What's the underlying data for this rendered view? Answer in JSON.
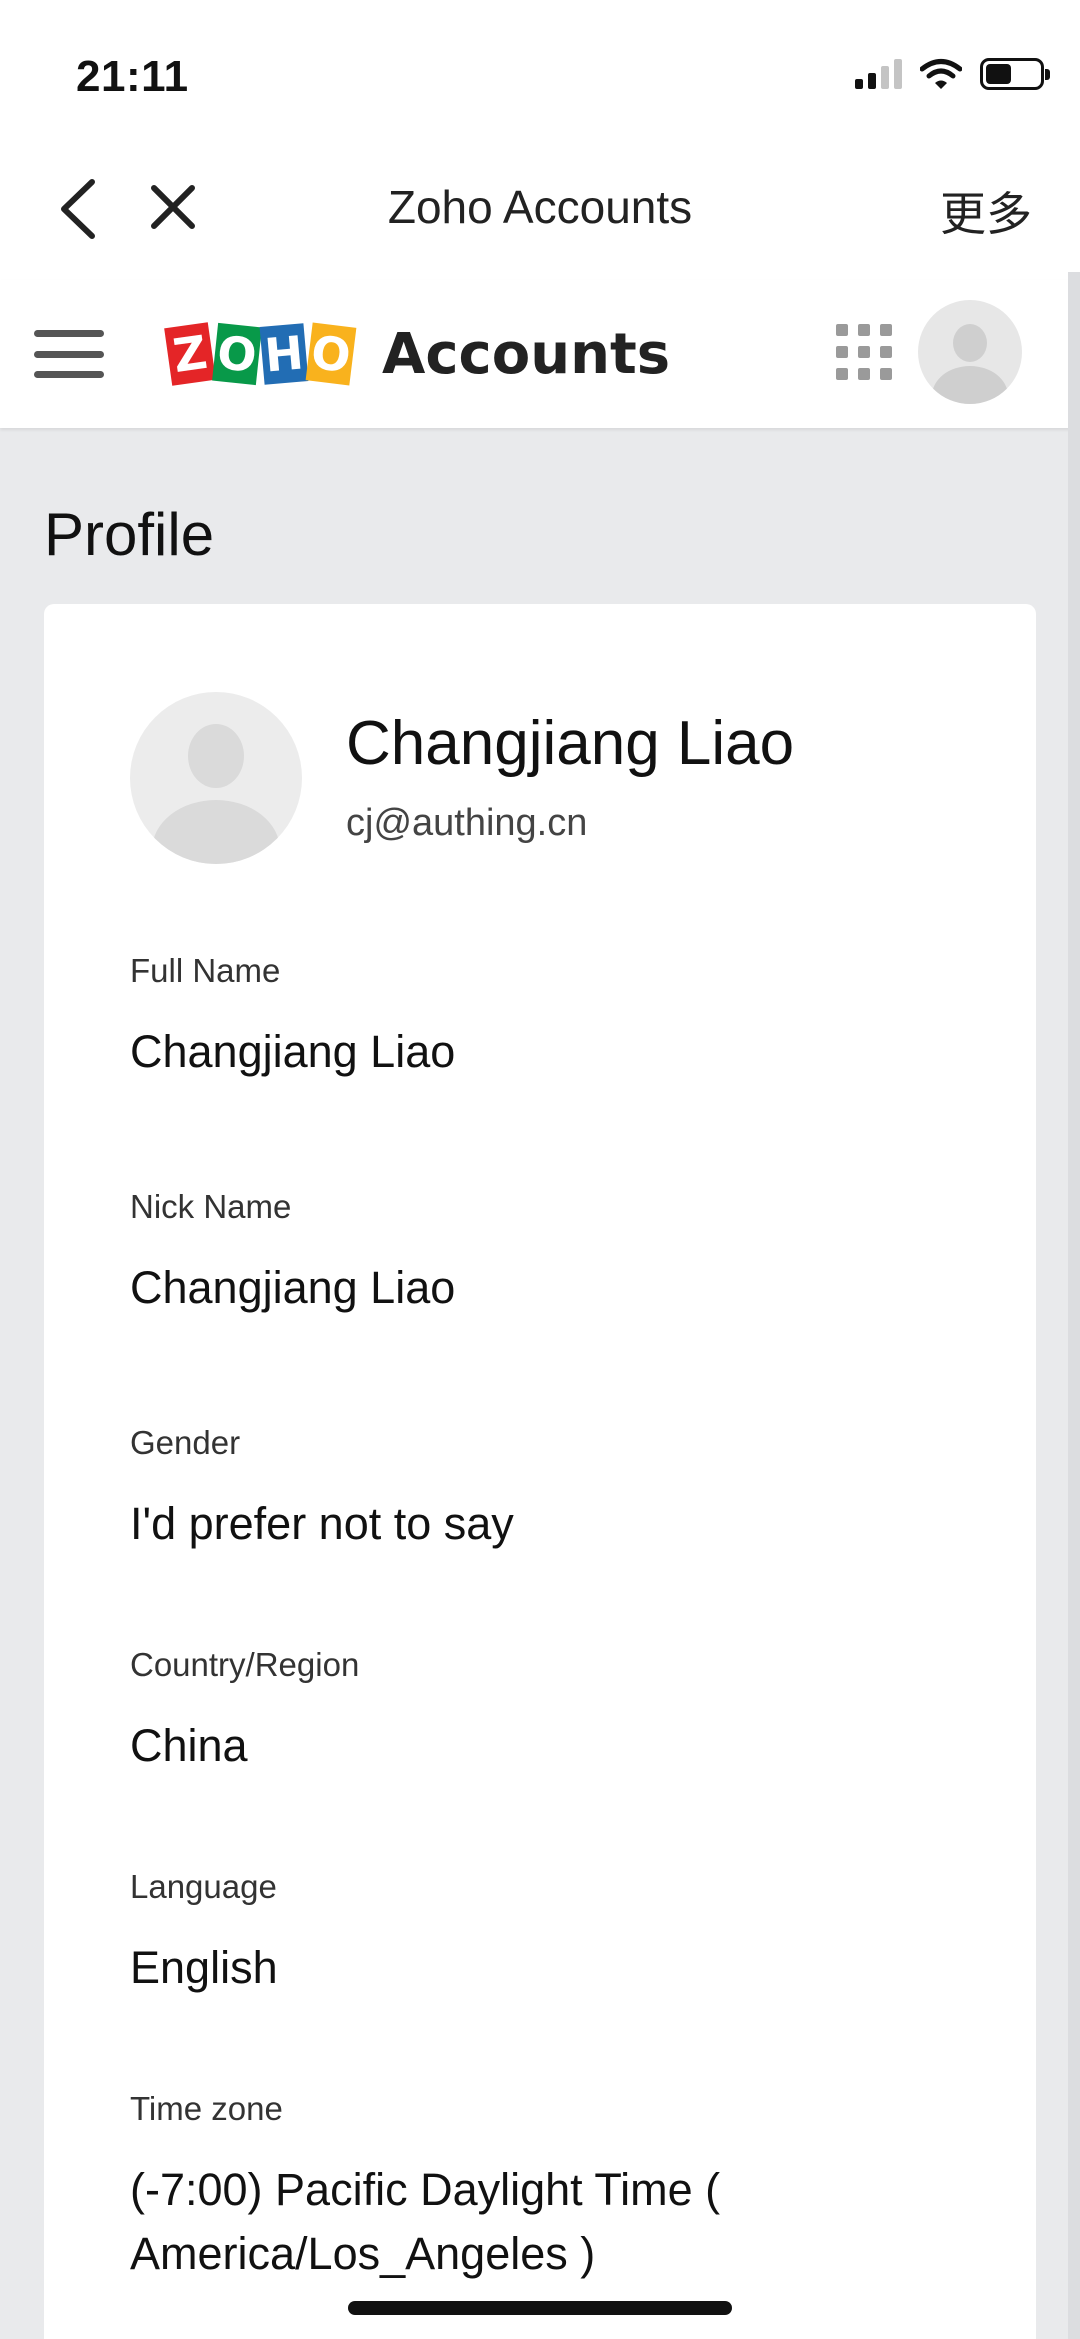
{
  "status_bar": {
    "time": "21:11"
  },
  "nav_bar": {
    "title": "Zoho Accounts",
    "more_label": "更多"
  },
  "app_header": {
    "logo_letters": [
      "Z",
      "O",
      "H",
      "O"
    ],
    "app_name": "Accounts"
  },
  "page": {
    "title": "Profile"
  },
  "profile": {
    "name": "Changjiang Liao",
    "email": "cj@authing.cn",
    "fields": [
      {
        "label": "Full Name",
        "value": "Changjiang Liao"
      },
      {
        "label": "Nick Name",
        "value": "Changjiang Liao"
      },
      {
        "label": "Gender",
        "value": "I'd prefer not to say"
      },
      {
        "label": "Country/Region",
        "value": "China"
      },
      {
        "label": "Language",
        "value": "English"
      },
      {
        "label": "Time zone",
        "value": "(-7:00) Pacific Daylight Time ( America/Los_Angeles )"
      }
    ]
  },
  "colors": {
    "zoho_red": "#e42527",
    "zoho_green": "#089949",
    "zoho_blue": "#226db4",
    "zoho_yellow": "#f9b21d",
    "page_background": "#e9eaec"
  }
}
